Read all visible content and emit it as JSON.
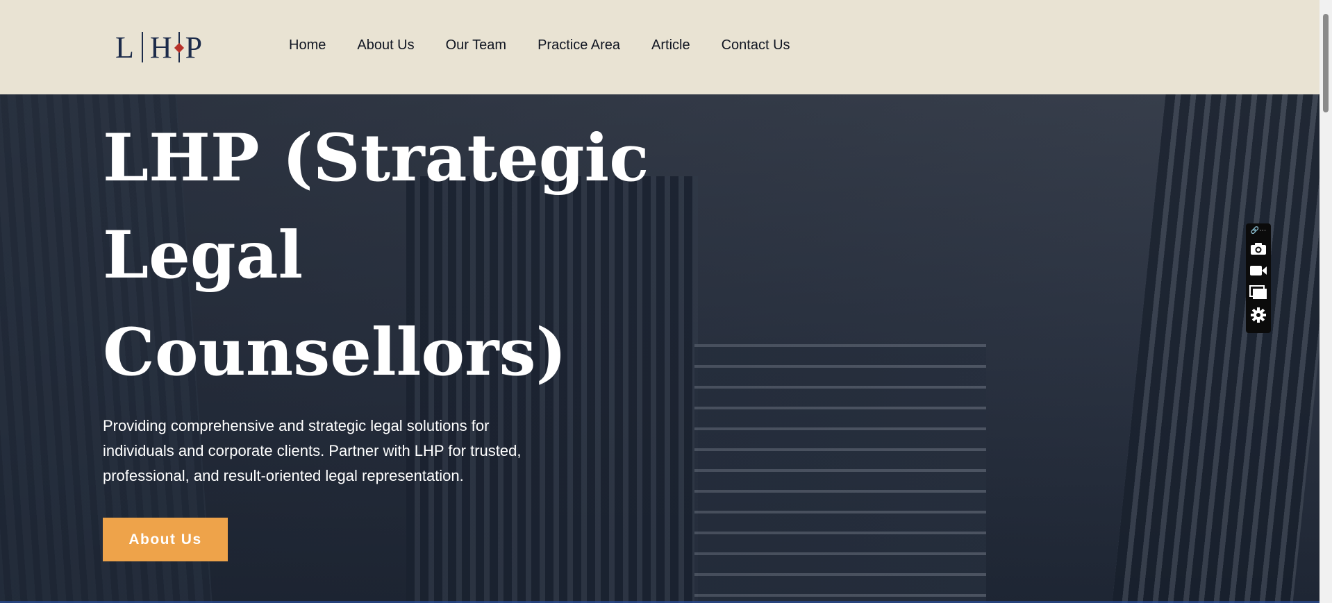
{
  "header": {
    "logo_text": "L|H|P",
    "nav": [
      {
        "label": "Home"
      },
      {
        "label": "About Us"
      },
      {
        "label": "Our Team"
      },
      {
        "label": "Practice Area"
      },
      {
        "label": "Article"
      },
      {
        "label": "Contact Us"
      }
    ]
  },
  "hero": {
    "title": "LHP (Strategic Legal Counsellors)",
    "description": "Providing comprehensive and strategic legal solutions for individuals and corporate clients. Partner with LHP for trusted, professional, and result-oriented legal representation.",
    "cta_label": "About Us"
  },
  "toolbar": {
    "icons": [
      "link-icon",
      "more-icon",
      "camera-icon",
      "video-icon",
      "window-icon",
      "gear-icon"
    ]
  },
  "colors": {
    "header_bg": "#e9e3d3",
    "brand_navy": "#1c2b4a",
    "accent_red": "#b8322a",
    "cta_orange": "#eea34a"
  }
}
